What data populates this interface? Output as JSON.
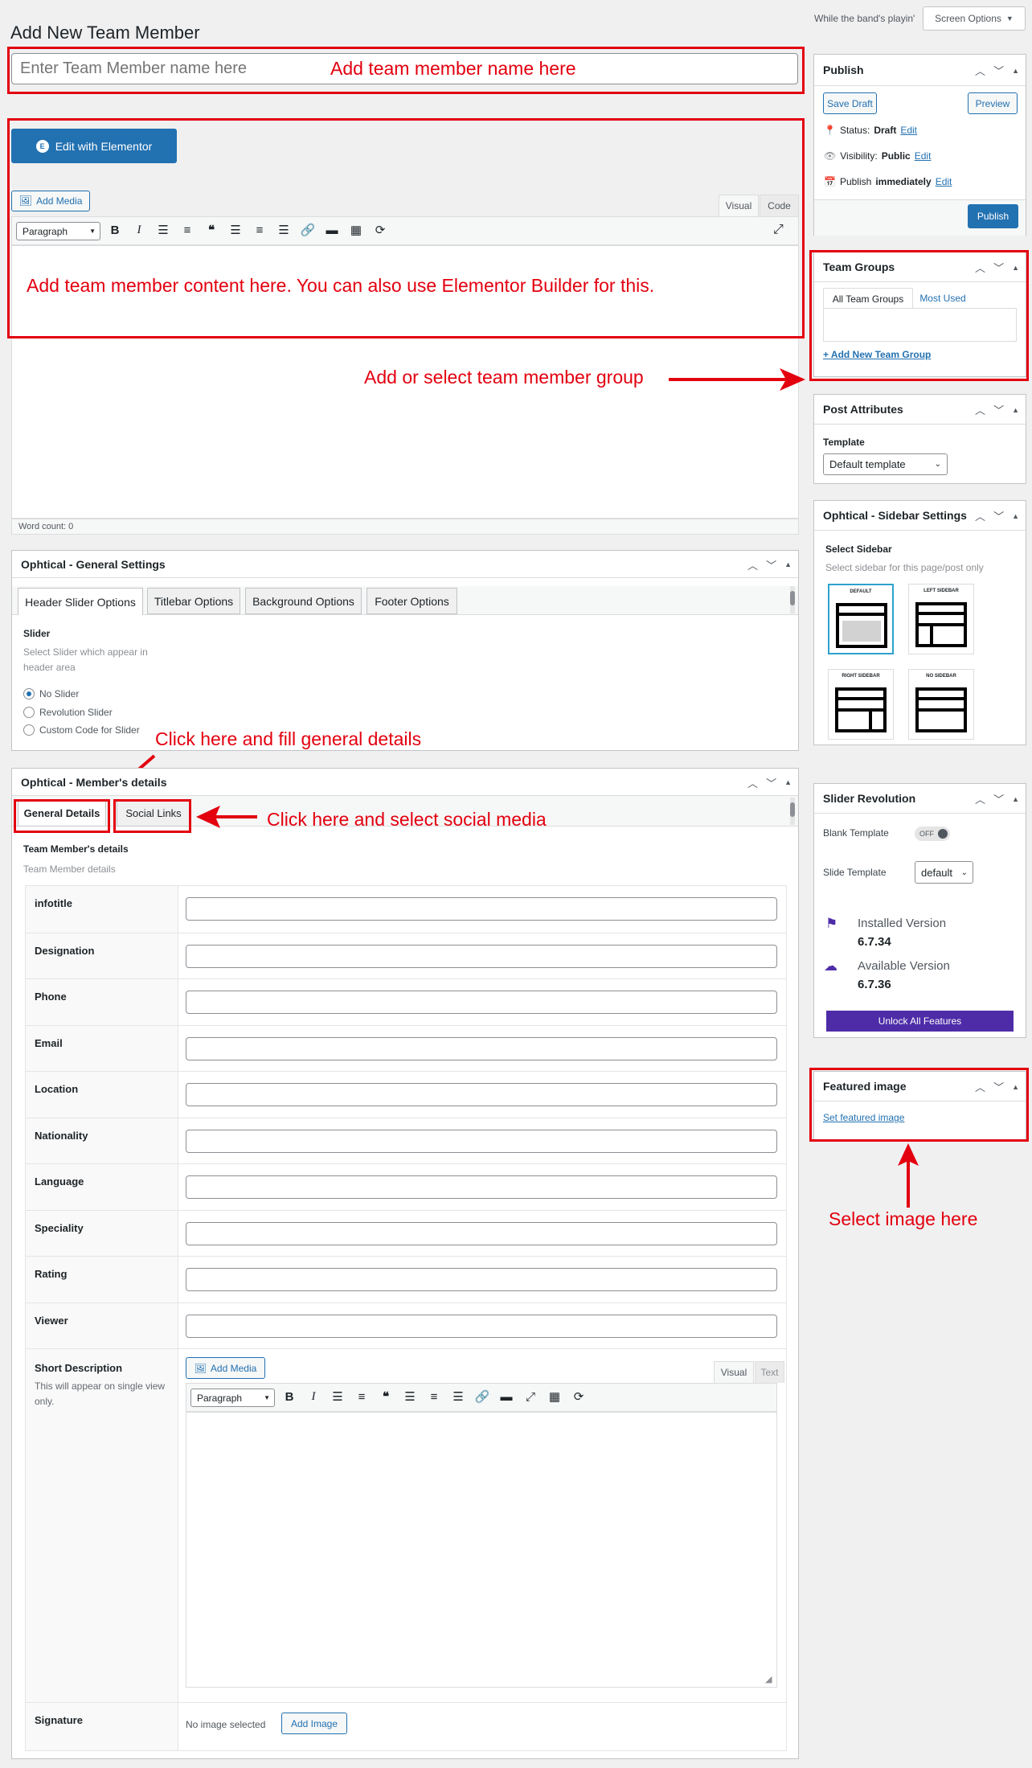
{
  "page": {
    "title": "Add New Team Member",
    "hint": "While the band's playin'",
    "screen_options": "Screen Options"
  },
  "title_field": {
    "placeholder": "Enter Team Member name here"
  },
  "editor": {
    "elementor_button": "Edit with Elementor",
    "add_media": "Add Media",
    "tab_visual": "Visual",
    "tab_code": "Code",
    "format": "Paragraph",
    "word_count": "Word count: 0"
  },
  "annotations": {
    "name": "Add team member name here",
    "content": "Add team member content here. You can also use Elementor Builder for this.",
    "group": "Add or select team member group",
    "general": "Click here and fill general details",
    "social": "Click here and select social media",
    "image": "Select image here"
  },
  "general_settings": {
    "title": "Ophtical - General Settings",
    "tabs": [
      "Header Slider Options",
      "Titlebar Options",
      "Background Options",
      "Footer Options"
    ],
    "slider_label": "Slider",
    "slider_desc_1": "Select Slider which appear in",
    "slider_desc_2": "header area",
    "options": [
      "No Slider",
      "Revolution Slider",
      "Custom Code for Slider"
    ]
  },
  "member_details": {
    "title": "Ophtical - Member's details",
    "tabs": [
      "General Details",
      "Social Links"
    ],
    "heading": "Team Member's details",
    "subheading": "Team Member details",
    "fields": [
      "infotitle",
      "Designation",
      "Phone",
      "Email",
      "Location",
      "Nationality",
      "Language",
      "Speciality",
      "Rating",
      "Viewer"
    ],
    "short_desc_label": "Short Description",
    "short_desc_help": "This will appear on single view only.",
    "short_add_media": "Add Media",
    "short_tab_visual": "Visual",
    "short_tab_text": "Text",
    "short_format": "Paragraph",
    "signature_label": "Signature",
    "no_image": "No image selected",
    "add_image": "Add Image"
  },
  "publish": {
    "title": "Publish",
    "save_draft": "Save Draft",
    "preview": "Preview",
    "status_label": "Status:",
    "status_value": "Draft",
    "visibility_label": "Visibility:",
    "visibility_value": "Public",
    "publish_label": "Publish",
    "publish_value": "immediately",
    "edit": "Edit",
    "publish_button": "Publish"
  },
  "team_groups": {
    "title": "Team Groups",
    "tab_all": "All Team Groups",
    "tab_most": "Most Used",
    "add_new": "+ Add New Team Group"
  },
  "post_attributes": {
    "title": "Post Attributes",
    "template_label": "Template",
    "template_value": "Default template"
  },
  "sidebar_settings": {
    "title": "Ophtical - Sidebar Settings",
    "label": "Select Sidebar",
    "desc": "Select sidebar for this page/post only",
    "options": [
      "DEFAULT",
      "LEFT SIDEBAR",
      "RIGHT SIDEBAR",
      "NO SIDEBAR"
    ]
  },
  "slider_revolution": {
    "title": "Slider Revolution",
    "blank_template": "Blank Template",
    "toggle": "OFF",
    "slide_template": "Slide Template",
    "slide_value": "default",
    "installed_label": "Installed Version",
    "installed_value": "6.7.34",
    "available_label": "Available Version",
    "available_value": "6.7.36",
    "unlock": "Unlock All Features"
  },
  "featured_image": {
    "title": "Featured image",
    "link": "Set featured image"
  },
  "colors": {
    "accent": "#2271b1",
    "annotation": "#e3000f",
    "purple": "#4e2ca8"
  }
}
